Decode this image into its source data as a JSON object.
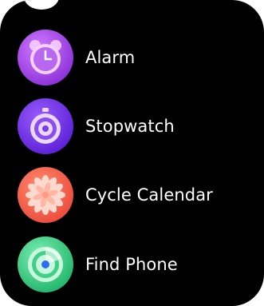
{
  "menu": {
    "items": [
      {
        "label": "Alarm",
        "icon": "alarm-clock-icon",
        "color": "#9b3de6"
      },
      {
        "label": "Stopwatch",
        "icon": "stopwatch-icon",
        "color": "#6b2be0"
      },
      {
        "label": "Cycle Calendar",
        "icon": "flower-icon",
        "color": "#f2594b"
      },
      {
        "label": "Find Phone",
        "icon": "radar-icon",
        "color": "#2ec07a"
      }
    ]
  }
}
